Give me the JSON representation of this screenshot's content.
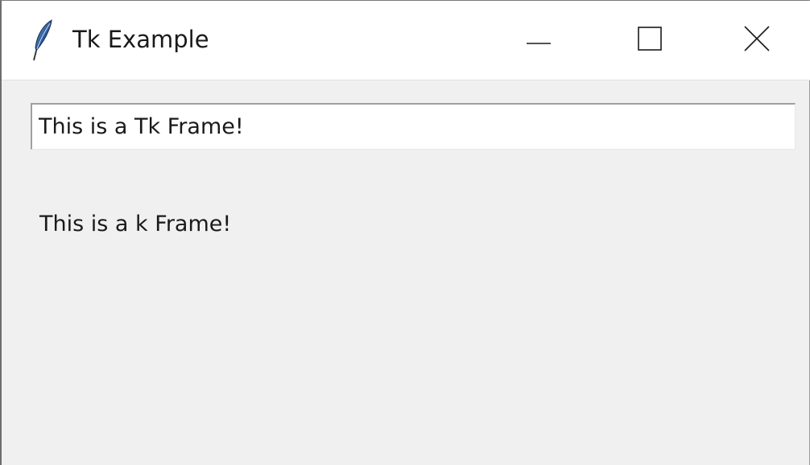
{
  "window": {
    "title": "Tk Example",
    "icon": "tk-feather-icon",
    "controls": {
      "minimize_icon": "minimize-icon",
      "maximize_icon": "maximize-icon",
      "close_icon": "close-icon"
    }
  },
  "entry": {
    "value": "This is a Tk Frame!"
  },
  "label": {
    "text": "This is a k Frame!"
  },
  "colors": {
    "background": "#f0f0f0",
    "titlebar": "#ffffff",
    "text": "#1a1a1a",
    "feather": "#1f4f8f"
  }
}
